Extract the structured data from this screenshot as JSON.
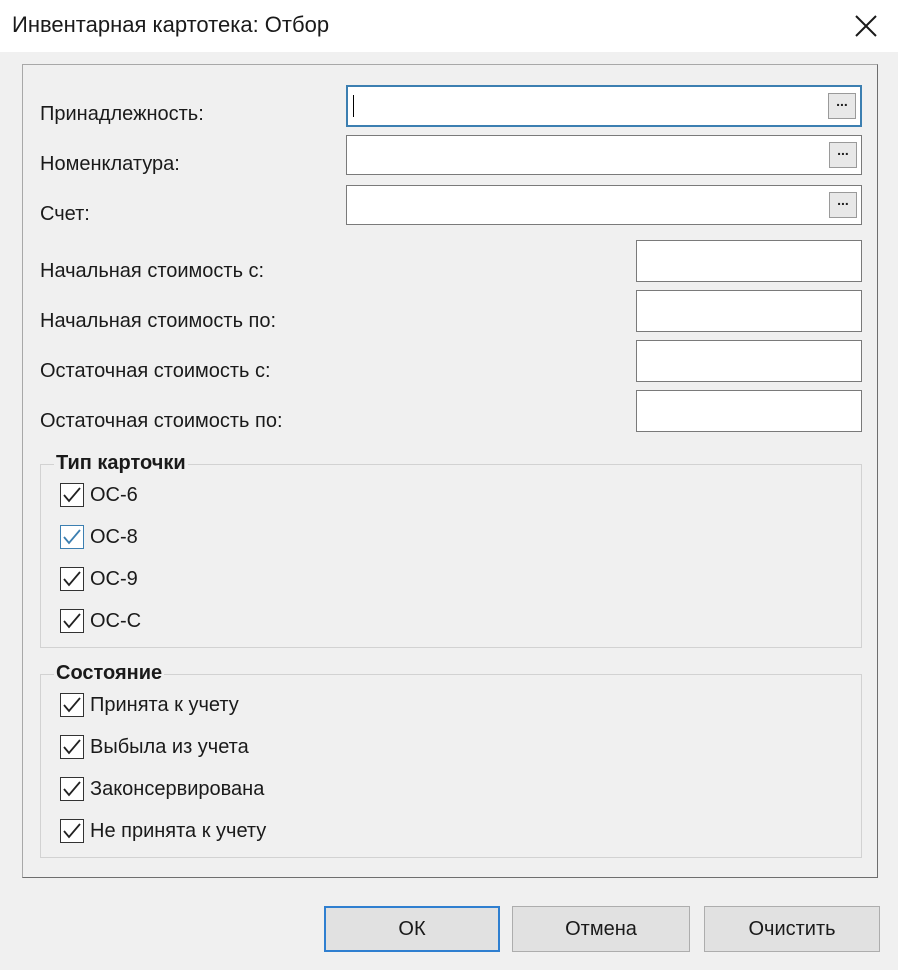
{
  "window": {
    "title": "Инвентарная картотека: Отбор"
  },
  "fields": {
    "affiliation": {
      "label": "Принадлежность:",
      "value": ""
    },
    "nomenclature": {
      "label": "Номенклатура:",
      "value": ""
    },
    "account": {
      "label": "Счет:",
      "value": ""
    },
    "initial_cost_from": {
      "label": "Начальная стоимость с:",
      "value": ""
    },
    "initial_cost_to": {
      "label": "Начальная стоимость по:",
      "value": ""
    },
    "residual_cost_from": {
      "label": "Остаточная стоимость с:",
      "value": ""
    },
    "residual_cost_to": {
      "label": "Остаточная стоимость по:",
      "value": ""
    },
    "select_button_label": "..."
  },
  "card_type": {
    "title": "Тип карточки",
    "items": [
      {
        "label": "ОС-6",
        "checked": true
      },
      {
        "label": "ОС-8",
        "checked": true
      },
      {
        "label": "ОС-9",
        "checked": true
      },
      {
        "label": "ОС-С",
        "checked": true
      }
    ]
  },
  "state": {
    "title": "Состояние",
    "items": [
      {
        "label": "Принята к учету",
        "checked": true
      },
      {
        "label": "Выбыла из учета",
        "checked": true
      },
      {
        "label": "Законсервирована",
        "checked": true
      },
      {
        "label": "Не принята к учету",
        "checked": true
      }
    ]
  },
  "buttons": {
    "ok": "ОК",
    "cancel": "Отмена",
    "clear": "Очистить"
  },
  "colors": {
    "focus_border": "#3c7fb1",
    "default_button_border": "#2f7fd0",
    "background": "#f0f0f0"
  }
}
